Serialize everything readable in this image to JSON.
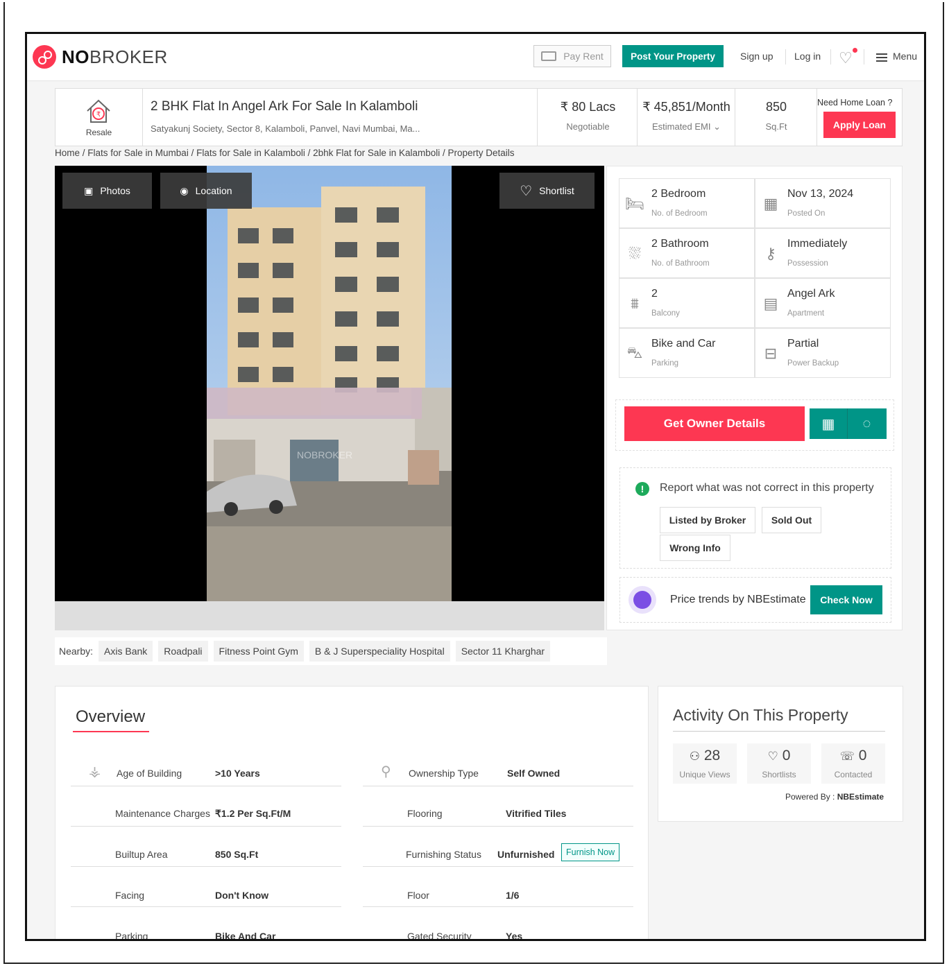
{
  "header": {
    "logo_text": "NOBROKER",
    "pay_rent": "Pay Rent",
    "post_property": "Post Your Property",
    "sign_up": "Sign up",
    "log_in": "Log in",
    "menu": "Menu"
  },
  "listing": {
    "category": "Resale",
    "title": "2 BHK Flat In Angel Ark For Sale In Kalamboli",
    "address": "Satyakunj Society, Sector 8, Kalamboli, Panvel, Navi Mumbai, Ma...",
    "price": "₹ 80 Lacs",
    "price_note": "Negotiable",
    "emi": "₹ 45,851/Month",
    "emi_note": "Estimated EMI",
    "area": "850",
    "area_unit": "Sq.Ft",
    "need_loan": "Need Home Loan ?",
    "apply_loan": "Apply Loan"
  },
  "breadcrumb": "Home / Flats for Sale in Mumbai / Flats for Sale in Kalamboli / 2bhk Flat for Sale in Kalamboli / Property Details",
  "gallery": {
    "photos": "Photos",
    "location": "Location",
    "shortlist": "Shortlist",
    "watermark": "NOBROKER"
  },
  "nearby": {
    "label": "Nearby:",
    "places": [
      "Axis Bank",
      "Roadpali",
      "Fitness Point Gym",
      "B & J Superspeciality Hospital",
      "Sector 11 Kharghar"
    ]
  },
  "specs": [
    {
      "value": "2 Bedroom",
      "label": "No. of Bedroom",
      "icon": "bed-icon"
    },
    {
      "value": "Nov 13, 2024",
      "label": "Posted On",
      "icon": "calendar-icon"
    },
    {
      "value": "2 Bathroom",
      "label": "No. of Bathroom",
      "icon": "bathtub-icon"
    },
    {
      "value": "Immediately",
      "label": "Possession",
      "icon": "key-icon"
    },
    {
      "value": "2",
      "label": "Balcony",
      "icon": "balcony-icon"
    },
    {
      "value": "Angel Ark",
      "label": "Apartment",
      "icon": "building-icon"
    },
    {
      "value": "Bike and Car",
      "label": "Parking",
      "icon": "car-icon"
    },
    {
      "value": "Partial",
      "label": "Power Backup",
      "icon": "battery-icon"
    }
  ],
  "actions": {
    "get_owner": "Get Owner Details"
  },
  "report": {
    "text": "Report what was not correct in this property",
    "options": [
      "Listed by Broker",
      "Sold Out",
      "Wrong Info"
    ]
  },
  "trends": {
    "text": "Price trends by NBEstimate",
    "button": "Check Now"
  },
  "overview": {
    "title": "Overview",
    "left": [
      {
        "label": "Age of Building",
        "value": ">10 Years"
      },
      {
        "label": "Maintenance Charges",
        "value": "₹1.2 Per Sq.Ft/M"
      },
      {
        "label": "Builtup Area",
        "value": "850 Sq.Ft"
      },
      {
        "label": "Facing",
        "value": "Don't Know"
      },
      {
        "label": "Parking",
        "value": "Bike And Car"
      }
    ],
    "right": [
      {
        "label": "Ownership Type",
        "value": "Self Owned"
      },
      {
        "label": "Flooring",
        "value": "Vitrified Tiles"
      },
      {
        "label": "Furnishing Status",
        "value": "Unfurnished"
      },
      {
        "label": "Floor",
        "value": "1/6"
      },
      {
        "label": "Gated Security",
        "value": "Yes"
      }
    ],
    "furnish_now": "Furnish Now"
  },
  "activity": {
    "title": "Activity On This Property",
    "views": "28",
    "views_label": "Unique Views",
    "shortlists": "0",
    "shortlists_label": "Shortlists",
    "contacted": "0",
    "contacted_label": "Contacted",
    "powered_label": "Powered By :",
    "powered_by": "NBEstimate"
  },
  "colors": {
    "brand_red": "#fd3752",
    "brand_green": "#009587"
  }
}
